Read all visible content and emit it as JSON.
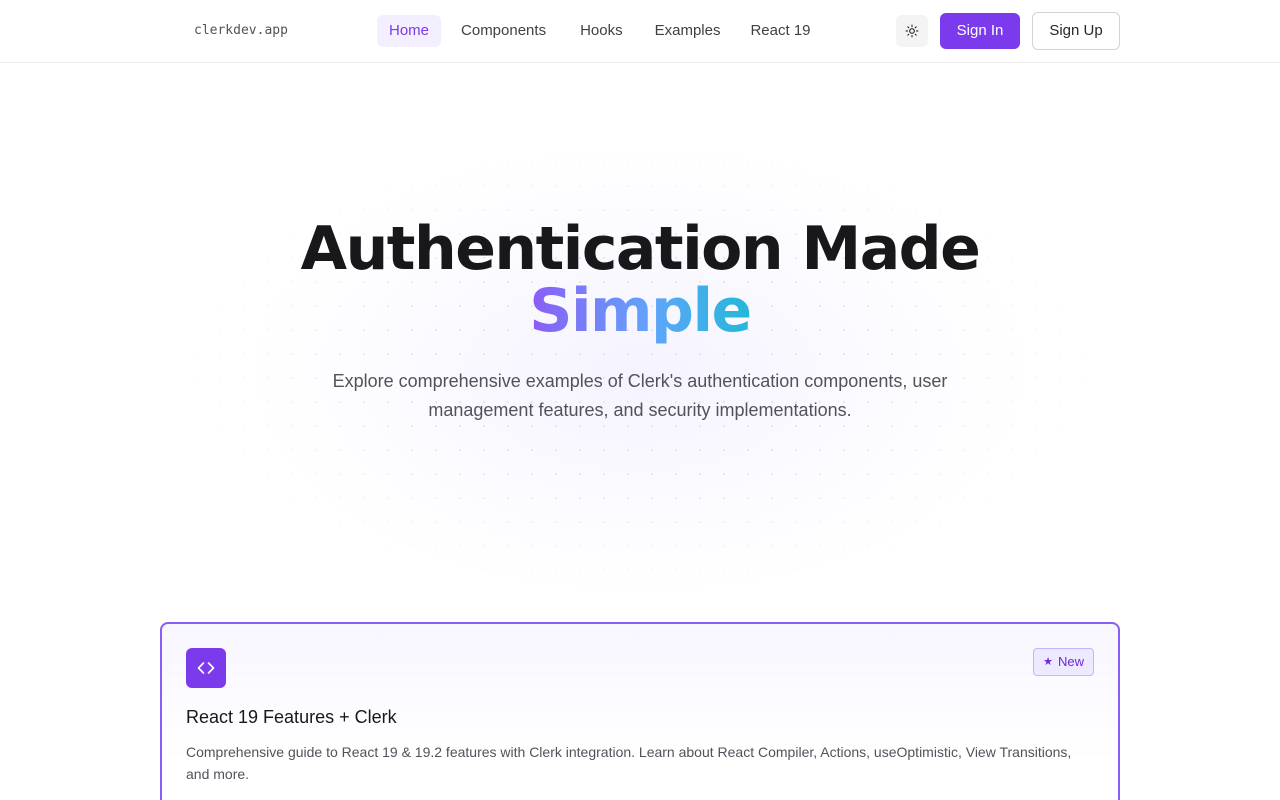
{
  "header": {
    "logo": "clerkdev.app",
    "nav": [
      {
        "label": "Home",
        "active": true
      },
      {
        "label": "Components",
        "active": false
      },
      {
        "label": "Hooks",
        "active": false
      },
      {
        "label": "Examples",
        "active": false
      },
      {
        "label": "React 19",
        "active": false
      }
    ],
    "theme_icon": "sun-icon",
    "sign_in": "Sign In",
    "sign_up": "Sign Up"
  },
  "hero": {
    "title_line1": "Authentication Made",
    "title_line2": "Simple",
    "subtitle": "Explore comprehensive examples of Clerk's authentication components, user management features, and security implementations."
  },
  "feature_card": {
    "icon": "code-icon",
    "badge_icon": "star-icon",
    "badge": "New",
    "title": "React 19 Features + Clerk",
    "description": "Comprehensive guide to React 19 & 19.2 features with Clerk integration. Learn about React Compiler, Actions, useOptimistic, View Transitions, and more."
  },
  "colors": {
    "accent": "#7c3aed",
    "accent_light": "#ede9fe",
    "gradient_start": "#8b5cf6",
    "gradient_end": "#22b8d8"
  }
}
